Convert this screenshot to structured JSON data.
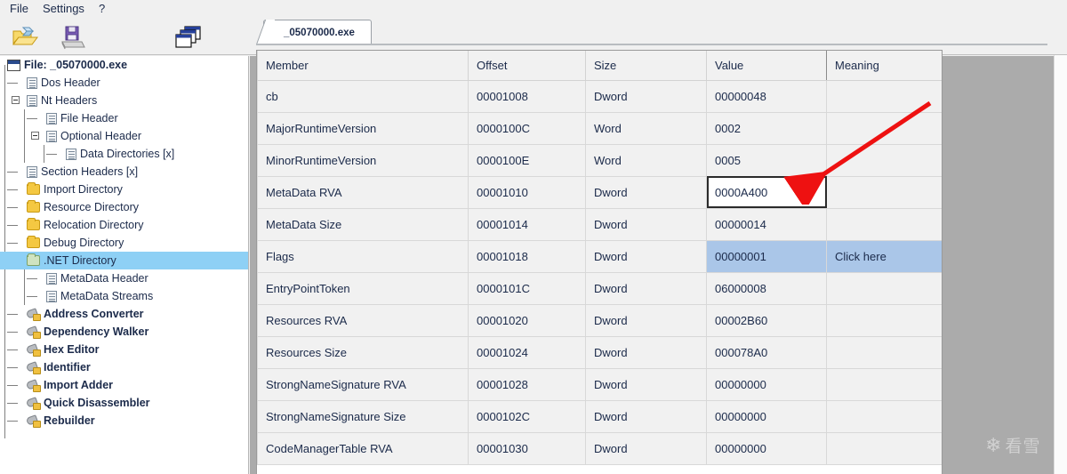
{
  "menu": {
    "items": [
      {
        "label": "File",
        "name": "menu-file"
      },
      {
        "label": "Settings",
        "name": "menu-settings"
      },
      {
        "label": "?",
        "name": "menu-help"
      }
    ]
  },
  "toolbar": {
    "buttons": [
      {
        "icon": "open-folder-icon",
        "name": "toolbar-open-file"
      },
      {
        "icon": "save-disk-icon",
        "name": "toolbar-save-file"
      },
      {
        "icon": "cascade-windows-icon",
        "name": "toolbar-windows"
      }
    ]
  },
  "tab": {
    "label": "_05070000.exe"
  },
  "tree": {
    "nodes": [
      {
        "label": "File: _05070000.exe",
        "icon": "window-icon",
        "depth": 0,
        "bold": true,
        "selected": false,
        "expander": "minus"
      },
      {
        "label": "Dos Header",
        "icon": "page-icon",
        "depth": 1,
        "bold": false,
        "selected": false,
        "expander": "none"
      },
      {
        "label": "Nt Headers",
        "icon": "page-icon",
        "depth": 1,
        "bold": false,
        "selected": false,
        "expander": "minus"
      },
      {
        "label": "File Header",
        "icon": "page-icon",
        "depth": 2,
        "bold": false,
        "selected": false,
        "expander": "none"
      },
      {
        "label": "Optional Header",
        "icon": "page-icon",
        "depth": 2,
        "bold": false,
        "selected": false,
        "expander": "minus"
      },
      {
        "label": "Data Directories [x]",
        "icon": "page-icon",
        "depth": 3,
        "bold": false,
        "selected": false,
        "expander": "none"
      },
      {
        "label": "Section Headers [x]",
        "icon": "page-icon",
        "depth": 1,
        "bold": false,
        "selected": false,
        "expander": "none"
      },
      {
        "label": "Import Directory",
        "icon": "folder-icon",
        "depth": 1,
        "bold": false,
        "selected": false,
        "expander": "none"
      },
      {
        "label": "Resource Directory",
        "icon": "folder-icon",
        "depth": 1,
        "bold": false,
        "selected": false,
        "expander": "none"
      },
      {
        "label": "Relocation Directory",
        "icon": "folder-icon",
        "depth": 1,
        "bold": false,
        "selected": false,
        "expander": "none"
      },
      {
        "label": "Debug Directory",
        "icon": "folder-icon",
        "depth": 1,
        "bold": false,
        "selected": false,
        "expander": "none"
      },
      {
        "label": ".NET Directory",
        "icon": "folder-green-icon",
        "depth": 1,
        "bold": false,
        "selected": true,
        "expander": "minus"
      },
      {
        "label": "MetaData Header",
        "icon": "page-icon",
        "depth": 2,
        "bold": false,
        "selected": false,
        "expander": "none"
      },
      {
        "label": "MetaData Streams",
        "icon": "page-icon",
        "depth": 2,
        "bold": false,
        "selected": false,
        "expander": "none"
      },
      {
        "label": "Address Converter",
        "icon": "tool-icon",
        "depth": 1,
        "bold": true,
        "selected": false,
        "expander": "none"
      },
      {
        "label": "Dependency Walker",
        "icon": "tool-icon",
        "depth": 1,
        "bold": true,
        "selected": false,
        "expander": "none"
      },
      {
        "label": "Hex Editor",
        "icon": "tool-icon",
        "depth": 1,
        "bold": true,
        "selected": false,
        "expander": "none"
      },
      {
        "label": "Identifier",
        "icon": "tool-icon",
        "depth": 1,
        "bold": true,
        "selected": false,
        "expander": "none"
      },
      {
        "label": "Import Adder",
        "icon": "tool-icon",
        "depth": 1,
        "bold": true,
        "selected": false,
        "expander": "none"
      },
      {
        "label": "Quick Disassembler",
        "icon": "tool-icon",
        "depth": 1,
        "bold": true,
        "selected": false,
        "expander": "none"
      },
      {
        "label": "Rebuilder",
        "icon": "tool-icon",
        "depth": 1,
        "bold": true,
        "selected": false,
        "expander": "none"
      }
    ]
  },
  "table": {
    "columns": [
      "Member",
      "Offset",
      "Size",
      "Value",
      "Meaning"
    ],
    "rows": [
      {
        "member": "cb",
        "offset": "00001008",
        "size": "Dword",
        "value": "00000048",
        "meaning": "",
        "highlight": false,
        "focused": false
      },
      {
        "member": "MajorRuntimeVersion",
        "offset": "0000100C",
        "size": "Word",
        "value": "0002",
        "meaning": "",
        "highlight": false,
        "focused": false
      },
      {
        "member": "MinorRuntimeVersion",
        "offset": "0000100E",
        "size": "Word",
        "value": "0005",
        "meaning": "",
        "highlight": false,
        "focused": false
      },
      {
        "member": "MetaData RVA",
        "offset": "00001010",
        "size": "Dword",
        "value": "0000A400",
        "meaning": "",
        "highlight": false,
        "focused": true
      },
      {
        "member": "MetaData Size",
        "offset": "00001014",
        "size": "Dword",
        "value": "00000014",
        "meaning": "",
        "highlight": false,
        "focused": false
      },
      {
        "member": "Flags",
        "offset": "00001018",
        "size": "Dword",
        "value": "00000001",
        "meaning": "Click here",
        "highlight": true,
        "focused": false
      },
      {
        "member": "EntryPointToken",
        "offset": "0000101C",
        "size": "Dword",
        "value": "06000008",
        "meaning": "",
        "highlight": false,
        "focused": false
      },
      {
        "member": "Resources RVA",
        "offset": "00001020",
        "size": "Dword",
        "value": "00002B60",
        "meaning": "",
        "highlight": false,
        "focused": false
      },
      {
        "member": "Resources Size",
        "offset": "00001024",
        "size": "Dword",
        "value": "000078A0",
        "meaning": "",
        "highlight": false,
        "focused": false
      },
      {
        "member": "StrongNameSignature RVA",
        "offset": "00001028",
        "size": "Dword",
        "value": "00000000",
        "meaning": "",
        "highlight": false,
        "focused": false
      },
      {
        "member": "StrongNameSignature Size",
        "offset": "0000102C",
        "size": "Dword",
        "value": "00000000",
        "meaning": "",
        "highlight": false,
        "focused": false
      },
      {
        "member": "CodeManagerTable RVA",
        "offset": "00001030",
        "size": "Dword",
        "value": "00000000",
        "meaning": "",
        "highlight": false,
        "focused": false
      }
    ]
  },
  "annotation": {
    "arrow_color": "#ee1111",
    "name": "red-pointer-arrow"
  },
  "watermark": {
    "flake": "❄",
    "text": "看雪"
  },
  "colors": {
    "selection_blue": "#8ed0f5",
    "row_highlight": "#aac6e8",
    "mdi_background": "#ababab",
    "chrome": "#f0f0f0"
  }
}
